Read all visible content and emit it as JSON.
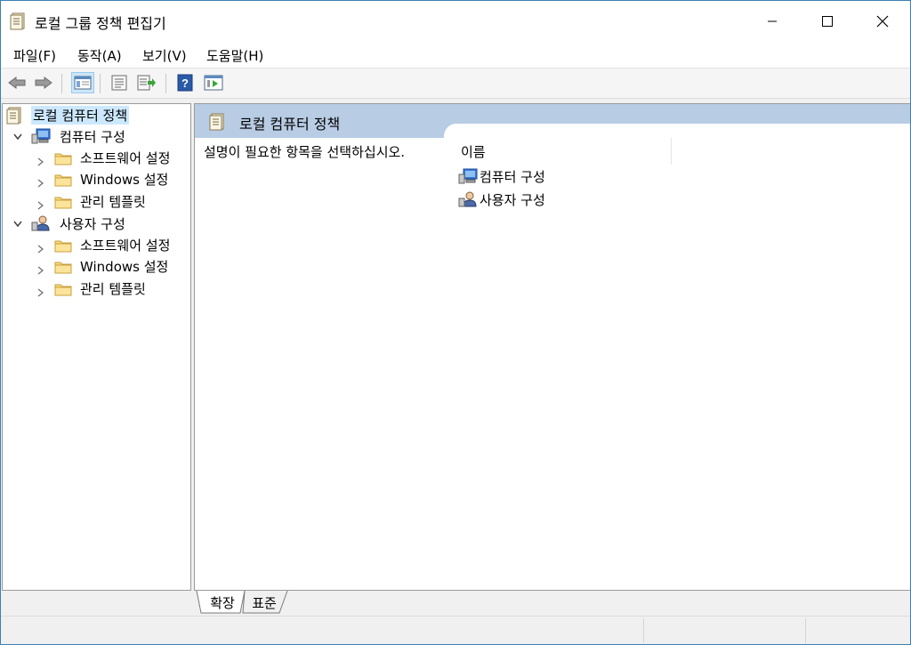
{
  "window": {
    "title": "로컬 그룹 정책 편집기",
    "icon": "policy-document-icon",
    "controls": [
      "minimize-icon",
      "maximize-icon",
      "close-icon"
    ]
  },
  "menu": [
    "파일(F)",
    "동작(A)",
    "보기(V)",
    "도움말(H)"
  ],
  "toolbar": {
    "buttons": [
      "back-arrow-icon",
      "forward-arrow-icon",
      "show-hide-console-tree-icon",
      "properties-icon",
      "export-list-icon",
      "help-icon",
      "show-hide-action-pane-icon"
    ]
  },
  "tree": {
    "root": "로컬 컴퓨터 정책",
    "computer": {
      "label": "컴퓨터 구성",
      "children": [
        "소프트웨어 설정",
        "Windows 설정",
        "관리 템플릿"
      ]
    },
    "user": {
      "label": "사용자 구성",
      "children": [
        "소프트웨어 설정",
        "Windows 설정",
        "관리 템플릿"
      ]
    }
  },
  "main": {
    "header_title": "로컬 컴퓨터 정책",
    "description": "설명이 필요한 항목을 선택하십시오.",
    "column_name": "이름",
    "items": [
      "컴퓨터 구성",
      "사용자 구성"
    ]
  },
  "tabs": {
    "extended": "확장",
    "standard": "표준"
  },
  "colors": {
    "header_bg": "#b8cce4",
    "selection_bg": "#cce8ff",
    "folder_yellow": "#f8d775"
  }
}
